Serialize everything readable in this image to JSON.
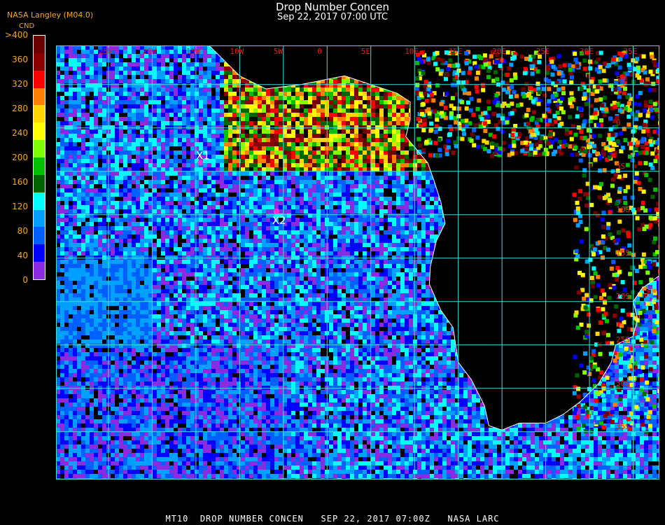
{
  "header": {
    "org": "NASA Langley (M04.0)",
    "title": "Drop Number Concen",
    "subtitle": "Sep 22, 2017 07:00 UTC"
  },
  "legend": {
    "unit": "CND",
    "ticks": [
      ">400",
      "360",
      "320",
      "280",
      "240",
      "200",
      "160",
      "120",
      "80",
      "40",
      "0"
    ],
    "colors": [
      "#6a0000",
      "#8b0000",
      "#ff0000",
      "#ff8000",
      "#ffd700",
      "#ffff00",
      "#80ff00",
      "#00c000",
      "#006400",
      "#00ffff",
      "#00a0ff",
      "#0060ff",
      "#0000ff",
      "#8a2be2"
    ]
  },
  "map": {
    "lon_labels": [
      "25W",
      "20W",
      "15W",
      "10W",
      "5W",
      "0",
      "5E",
      "10E",
      "15E",
      "20E",
      "25E",
      "30E",
      "35E"
    ],
    "lat_labels": [
      "5N",
      "0",
      "5S",
      "10S",
      "15S",
      "20S",
      "25S",
      "30S",
      "35S"
    ],
    "markers": [
      {
        "label": "X1",
        "lon": -14.5,
        "lat": -4.0
      },
      {
        "label": "X2",
        "lon": -5.8,
        "lat": -9.6
      }
    ],
    "colors": {
      "grid": "#40e0e0",
      "coast": "#ffffff",
      "marker": "#ff33cc",
      "grid_label": "#e02020"
    }
  },
  "footer": {
    "text": "MT10  DROP NUMBER CONCEN   SEP 22, 2017 07:00Z   NASA LARC"
  }
}
